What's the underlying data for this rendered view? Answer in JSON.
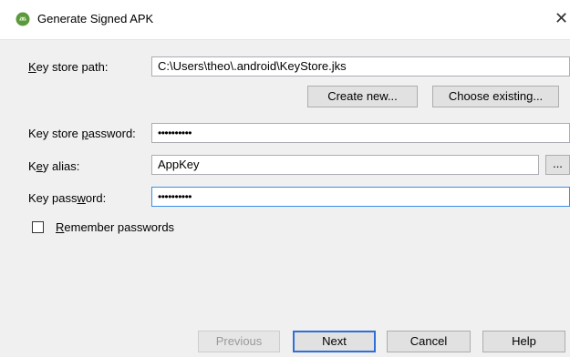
{
  "window": {
    "title": "Generate Signed APK",
    "close_glyph": "✕",
    "icon": "android-icon"
  },
  "form": {
    "keystore_path": {
      "label_pre": "",
      "label_u": "K",
      "label_post": "ey store path:",
      "value": "C:\\Users\\theo\\.android\\KeyStore.jks"
    },
    "create_new_label": "Create new...",
    "choose_existing_label": "Choose existing...",
    "keystore_password": {
      "label_pre": "Key store ",
      "label_u": "p",
      "label_post": "assword:",
      "value": "••••••••••"
    },
    "key_alias": {
      "label_pre": "K",
      "label_u": "e",
      "label_post": "y alias:",
      "value": "AppKey",
      "browse_label": "..."
    },
    "key_password": {
      "label_pre": "Key pass",
      "label_u": "w",
      "label_post": "ord:",
      "value": "••••••••••"
    },
    "remember": {
      "label_u": "R",
      "label_post": "emember passwords",
      "checked": false
    }
  },
  "footer": {
    "previous_label": "Previous",
    "next_label": "Next",
    "cancel_label": "Cancel",
    "help_label": "Help"
  }
}
